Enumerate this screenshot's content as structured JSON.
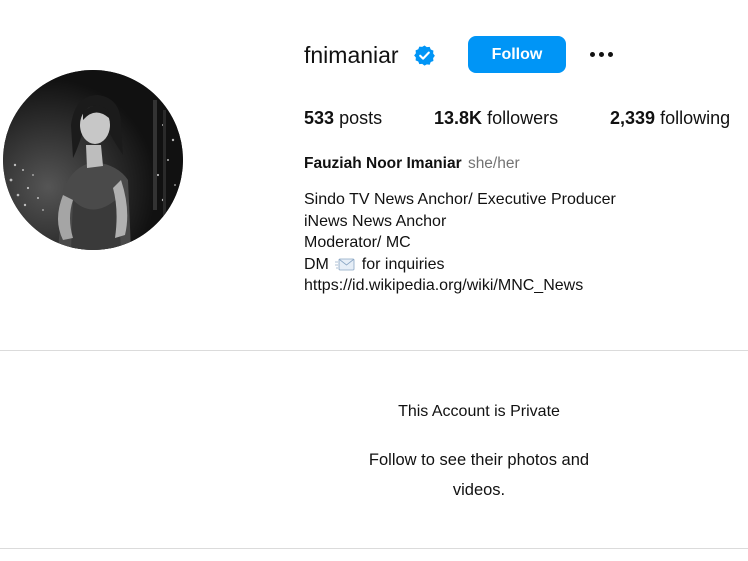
{
  "profile": {
    "username": "fnimaniar",
    "verified_icon": "verified-badge-icon",
    "follow_label": "Follow",
    "more_icon": "more-options-icon",
    "avatar_alt": "profile-photo"
  },
  "stats": {
    "posts_count": "533",
    "posts_label": "posts",
    "followers_count": "13.8K",
    "followers_label": "followers",
    "following_count": "2,339",
    "following_label": "following"
  },
  "bio": {
    "full_name": "Fauziah Noor Imaniar",
    "pronouns": "she/her",
    "line1": "Sindo TV News Anchor/ Executive Producer",
    "line2": "iNews News Anchor",
    "line3": "Moderator/ MC",
    "line4_prefix": "DM",
    "line4_icon": "envelope-icon",
    "line4_suffix": "for inquiries",
    "link": "https://id.wikipedia.org/wiki/MNC_News"
  },
  "private": {
    "title": "This Account is Private",
    "message": "Follow to see their photos and videos."
  },
  "colors": {
    "accent": "#0095f6",
    "verified": "#0095f6",
    "divider": "#dbdbdb",
    "muted": "#737373"
  }
}
